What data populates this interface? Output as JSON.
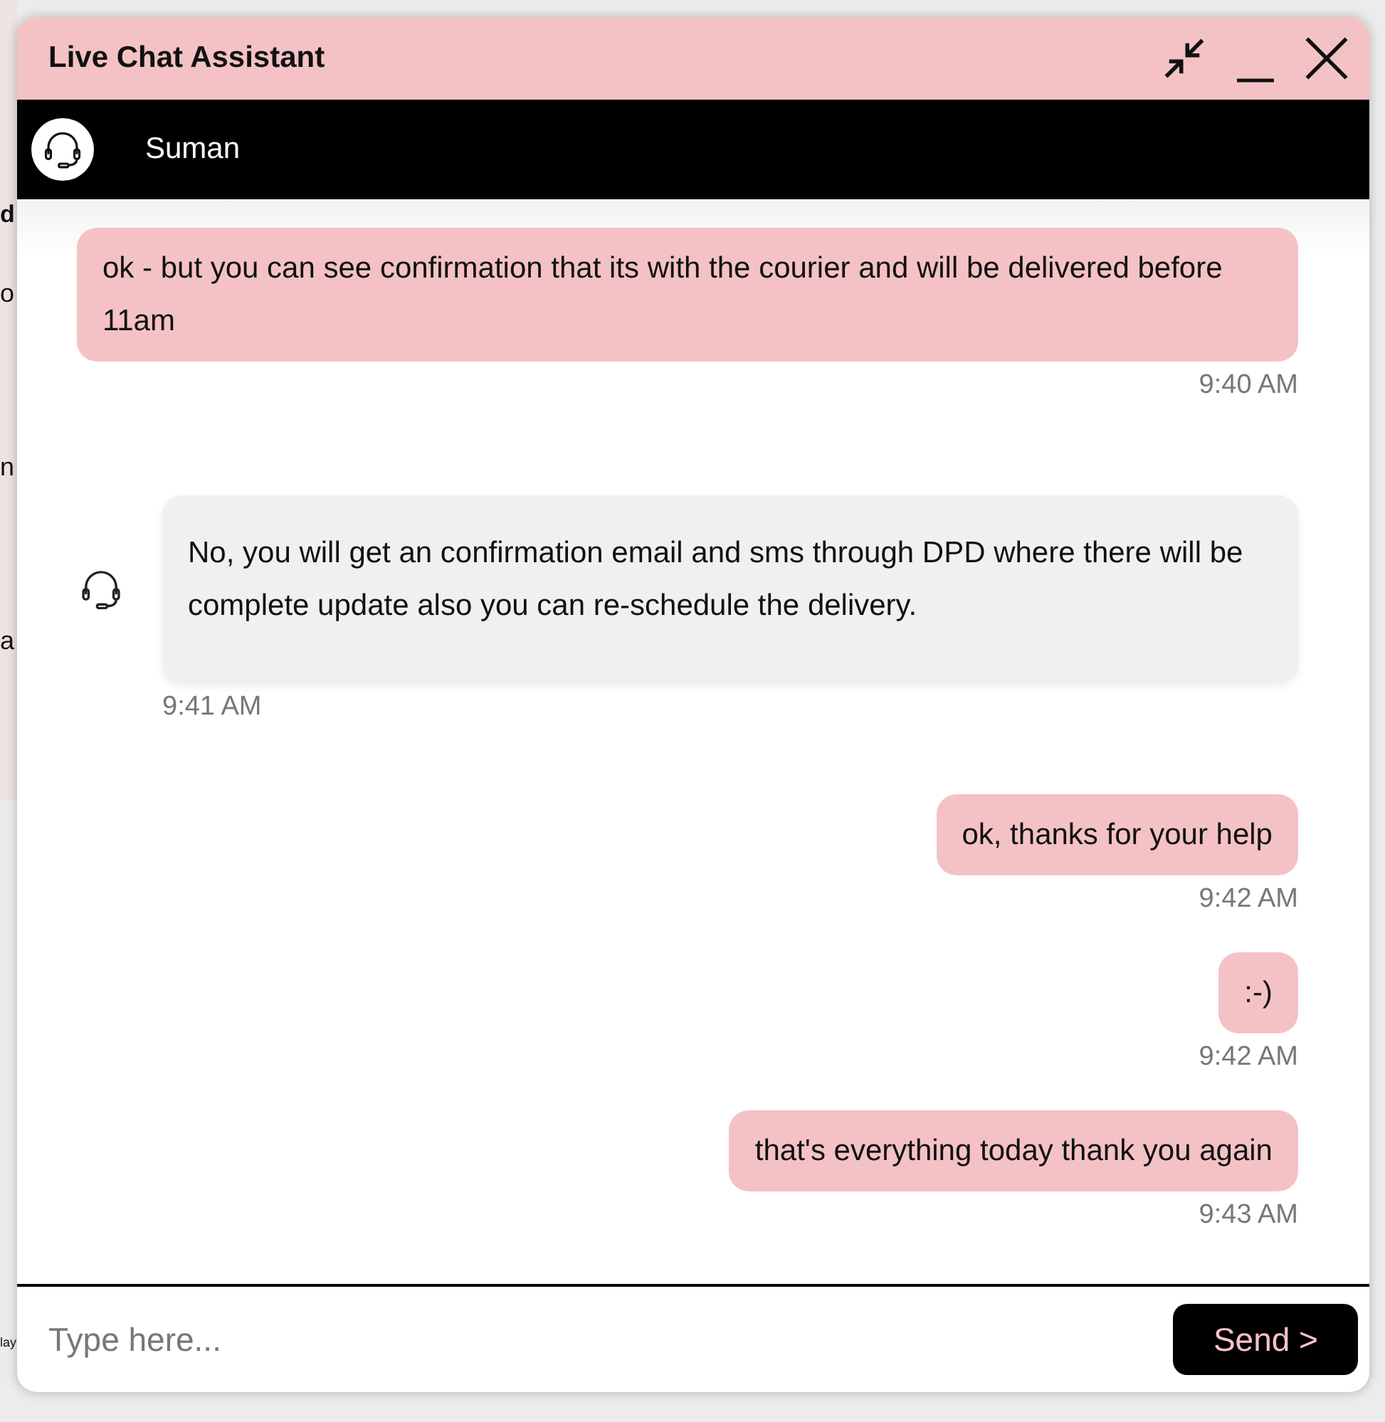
{
  "background_page": {
    "fragments": [
      "d",
      "o",
      "n",
      "a",
      "lay"
    ]
  },
  "window": {
    "title": "Live Chat Assistant"
  },
  "agent": {
    "name": "Suman"
  },
  "messages": [
    {
      "kind": "user",
      "text": "ok - but you can see confirmation that its with the courier and will be delivered before 11am",
      "time": "9:40 AM"
    },
    {
      "kind": "agent",
      "text": "No, you will get an confirmation email and sms through DPD where there will be complete update also you can re-schedule the delivery.",
      "time": "9:41 AM"
    },
    {
      "kind": "user",
      "text": "ok, thanks for your help",
      "time": "9:42 AM"
    },
    {
      "kind": "user",
      "text": ":-)",
      "time": "9:42 AM"
    },
    {
      "kind": "user",
      "text": "that's everything today thank you again",
      "time": "9:43 AM"
    }
  ],
  "composer": {
    "placeholder": "Type here...",
    "send_label": "Send >"
  }
}
